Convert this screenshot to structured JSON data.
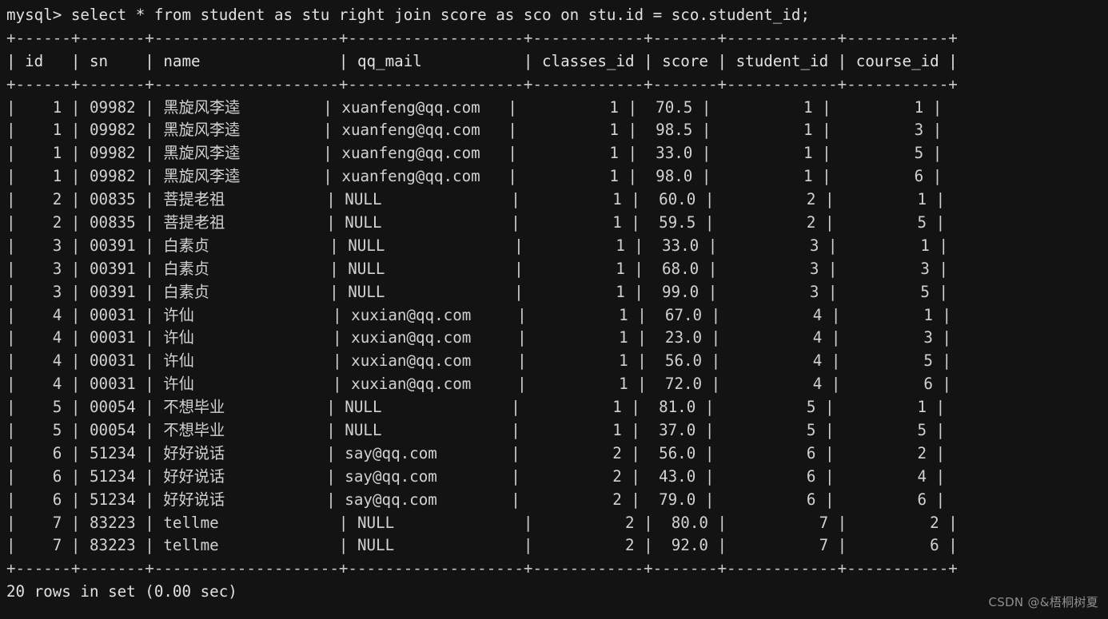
{
  "terminal": {
    "prompt": "mysql> ",
    "command": "select * from student as stu right join score as sco on stu.id = sco.student_id;",
    "prompt_line": "mysql> select * from student as stu right join score as sco on stu.id = sco.student_id;",
    "colors": {
      "background": "#131313",
      "foreground": "#d2d2d2",
      "watermark": "#8f8f8f"
    }
  },
  "result": {
    "rule": "+------+-------+--------------------+-------------------+------------+-------+------------+-----------+",
    "header_line": "| id   | sn    | name               | qq_mail           | classes_id | score | student_id | course_id |",
    "columns": [
      "id",
      "sn",
      "name",
      "qq_mail",
      "classes_id",
      "score",
      "student_id",
      "course_id"
    ],
    "rows": [
      {
        "line": "|    1 | 09982 | 黑旋风李逵         | xuanfeng@qq.com   |          1 |  70.5 |          1 |         1 |",
        "id": "1",
        "sn": "09982",
        "name": "黑旋风李逵",
        "qq_mail": "xuanfeng@qq.com",
        "classes_id": "1",
        "score": "70.5",
        "student_id": "1",
        "course_id": "1"
      },
      {
        "line": "|    1 | 09982 | 黑旋风李逵         | xuanfeng@qq.com   |          1 |  98.5 |          1 |         3 |",
        "id": "1",
        "sn": "09982",
        "name": "黑旋风李逵",
        "qq_mail": "xuanfeng@qq.com",
        "classes_id": "1",
        "score": "98.5",
        "student_id": "1",
        "course_id": "3"
      },
      {
        "line": "|    1 | 09982 | 黑旋风李逵         | xuanfeng@qq.com   |          1 |  33.0 |          1 |         5 |",
        "id": "1",
        "sn": "09982",
        "name": "黑旋风李逵",
        "qq_mail": "xuanfeng@qq.com",
        "classes_id": "1",
        "score": "33.0",
        "student_id": "1",
        "course_id": "5"
      },
      {
        "line": "|    1 | 09982 | 黑旋风李逵         | xuanfeng@qq.com   |          1 |  98.0 |          1 |         6 |",
        "id": "1",
        "sn": "09982",
        "name": "黑旋风李逵",
        "qq_mail": "xuanfeng@qq.com",
        "classes_id": "1",
        "score": "98.0",
        "student_id": "1",
        "course_id": "6"
      },
      {
        "line": "|    2 | 00835 | 菩提老祖           | NULL              |          1 |  60.0 |          2 |         1 |",
        "id": "2",
        "sn": "00835",
        "name": "菩提老祖",
        "qq_mail": "NULL",
        "classes_id": "1",
        "score": "60.0",
        "student_id": "2",
        "course_id": "1"
      },
      {
        "line": "|    2 | 00835 | 菩提老祖           | NULL              |          1 |  59.5 |          2 |         5 |",
        "id": "2",
        "sn": "00835",
        "name": "菩提老祖",
        "qq_mail": "NULL",
        "classes_id": "1",
        "score": "59.5",
        "student_id": "2",
        "course_id": "5"
      },
      {
        "line": "|    3 | 00391 | 白素贞             | NULL              |          1 |  33.0 |          3 |         1 |",
        "id": "3",
        "sn": "00391",
        "name": "白素贞",
        "qq_mail": "NULL",
        "classes_id": "1",
        "score": "33.0",
        "student_id": "3",
        "course_id": "1"
      },
      {
        "line": "|    3 | 00391 | 白素贞             | NULL              |          1 |  68.0 |          3 |         3 |",
        "id": "3",
        "sn": "00391",
        "name": "白素贞",
        "qq_mail": "NULL",
        "classes_id": "1",
        "score": "68.0",
        "student_id": "3",
        "course_id": "3"
      },
      {
        "line": "|    3 | 00391 | 白素贞             | NULL              |          1 |  99.0 |          3 |         5 |",
        "id": "3",
        "sn": "00391",
        "name": "白素贞",
        "qq_mail": "NULL",
        "classes_id": "1",
        "score": "99.0",
        "student_id": "3",
        "course_id": "5"
      },
      {
        "line": "|    4 | 00031 | 许仙               | xuxian@qq.com     |          1 |  67.0 |          4 |         1 |",
        "id": "4",
        "sn": "00031",
        "name": "许仙",
        "qq_mail": "xuxian@qq.com",
        "classes_id": "1",
        "score": "67.0",
        "student_id": "4",
        "course_id": "1"
      },
      {
        "line": "|    4 | 00031 | 许仙               | xuxian@qq.com     |          1 |  23.0 |          4 |         3 |",
        "id": "4",
        "sn": "00031",
        "name": "许仙",
        "qq_mail": "xuxian@qq.com",
        "classes_id": "1",
        "score": "23.0",
        "student_id": "4",
        "course_id": "3"
      },
      {
        "line": "|    4 | 00031 | 许仙               | xuxian@qq.com     |          1 |  56.0 |          4 |         5 |",
        "id": "4",
        "sn": "00031",
        "name": "许仙",
        "qq_mail": "xuxian@qq.com",
        "classes_id": "1",
        "score": "56.0",
        "student_id": "4",
        "course_id": "5"
      },
      {
        "line": "|    4 | 00031 | 许仙               | xuxian@qq.com     |          1 |  72.0 |          4 |         6 |",
        "id": "4",
        "sn": "00031",
        "name": "许仙",
        "qq_mail": "xuxian@qq.com",
        "classes_id": "1",
        "score": "72.0",
        "student_id": "4",
        "course_id": "6"
      },
      {
        "line": "|    5 | 00054 | 不想毕业           | NULL              |          1 |  81.0 |          5 |         1 |",
        "id": "5",
        "sn": "00054",
        "name": "不想毕业",
        "qq_mail": "NULL",
        "classes_id": "1",
        "score": "81.0",
        "student_id": "5",
        "course_id": "1"
      },
      {
        "line": "|    5 | 00054 | 不想毕业           | NULL              |          1 |  37.0 |          5 |         5 |",
        "id": "5",
        "sn": "00054",
        "name": "不想毕业",
        "qq_mail": "NULL",
        "classes_id": "1",
        "score": "37.0",
        "student_id": "5",
        "course_id": "5"
      },
      {
        "line": "|    6 | 51234 | 好好说话           | say@qq.com        |          2 |  56.0 |          6 |         2 |",
        "id": "6",
        "sn": "51234",
        "name": "好好说话",
        "qq_mail": "say@qq.com",
        "classes_id": "2",
        "score": "56.0",
        "student_id": "6",
        "course_id": "2"
      },
      {
        "line": "|    6 | 51234 | 好好说话           | say@qq.com        |          2 |  43.0 |          6 |         4 |",
        "id": "6",
        "sn": "51234",
        "name": "好好说话",
        "qq_mail": "say@qq.com",
        "classes_id": "2",
        "score": "43.0",
        "student_id": "6",
        "course_id": "4"
      },
      {
        "line": "|    6 | 51234 | 好好说话           | say@qq.com        |          2 |  79.0 |          6 |         6 |",
        "id": "6",
        "sn": "51234",
        "name": "好好说话",
        "qq_mail": "say@qq.com",
        "classes_id": "2",
        "score": "79.0",
        "student_id": "6",
        "course_id": "6"
      },
      {
        "line": "|    7 | 83223 | tellme             | NULL              |          2 |  80.0 |          7 |         2 |",
        "id": "7",
        "sn": "83223",
        "name": "tellme",
        "qq_mail": "NULL",
        "classes_id": "2",
        "score": "80.0",
        "student_id": "7",
        "course_id": "2"
      },
      {
        "line": "|    7 | 83223 | tellme             | NULL              |          2 |  92.0 |          7 |         6 |",
        "id": "7",
        "sn": "83223",
        "name": "tellme",
        "qq_mail": "NULL",
        "classes_id": "2",
        "score": "92.0",
        "student_id": "7",
        "course_id": "6"
      }
    ],
    "row_count": 20,
    "elapsed": "0.00 sec",
    "footer": "20 rows in set (0.00 sec)"
  },
  "watermark": {
    "text": "CSDN @&梧桐树夏"
  }
}
